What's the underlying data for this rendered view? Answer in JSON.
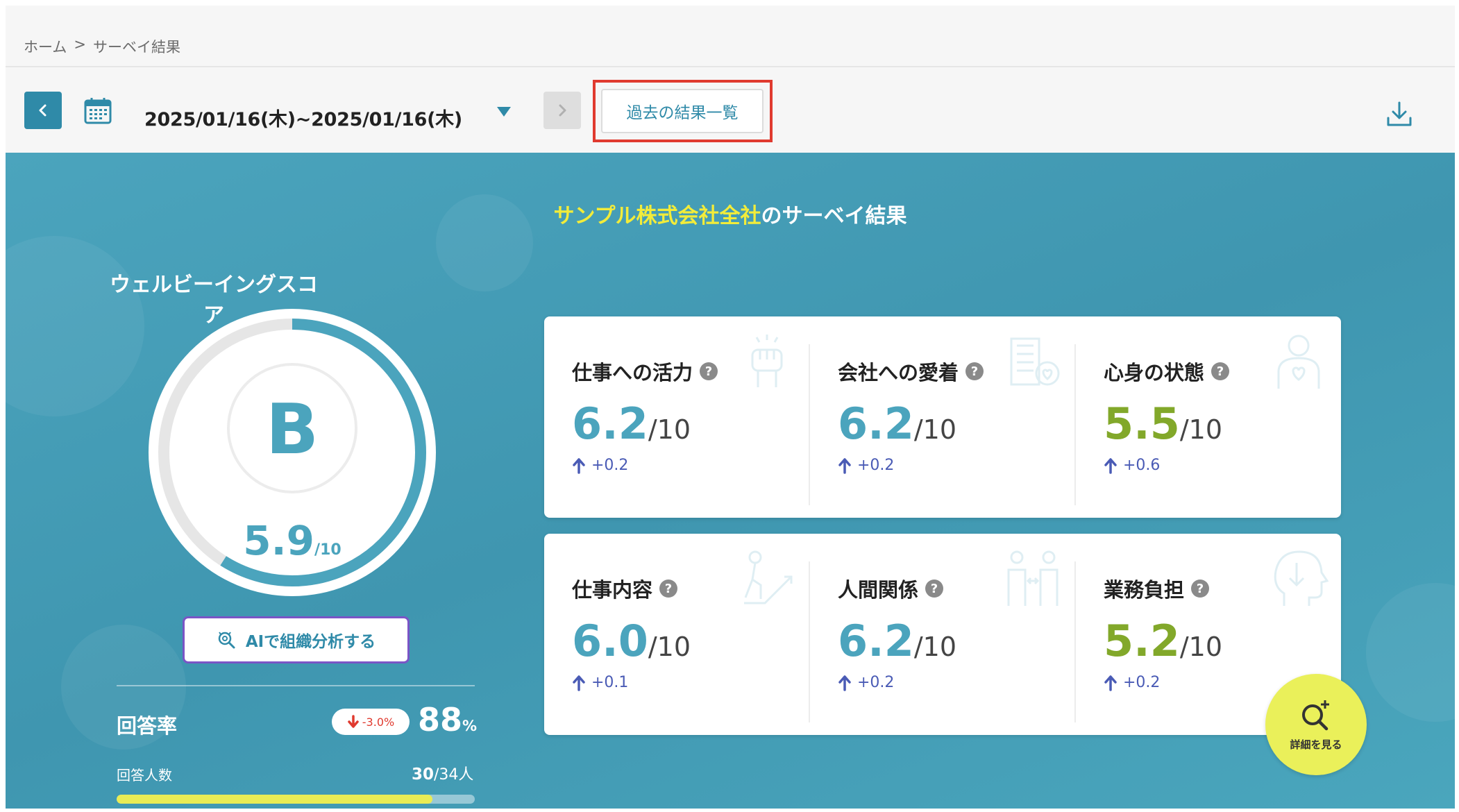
{
  "breadcrumb": {
    "home": "ホーム",
    "separator": ">",
    "current": "サーベイ結果"
  },
  "toolbar": {
    "date_range": "2025/01/16(木)~2025/01/16(木)",
    "history_button": "過去の結果一覧"
  },
  "panel": {
    "title_company": "サンプル株式会社全社",
    "title_suffix": "のサーベイ結果"
  },
  "wellbeing": {
    "label": "ウェルビーイングスコア",
    "grade": "B",
    "score": "5.9",
    "score_denominator": "/10",
    "score_fraction": 0.59,
    "ai_button": "AIで組織分析する"
  },
  "response": {
    "rate_label": "回答率",
    "rate_change": "-3.0%",
    "rate_value": "88",
    "rate_unit": "%",
    "count_label": "回答人数",
    "count_answered": "30",
    "count_total": "/34人",
    "progress_fraction": 0.882
  },
  "metrics": [
    {
      "name": "仕事への活力",
      "score": "6.2",
      "denominator": "/10",
      "delta": "+0.2",
      "color": "#4ba4bd",
      "icon": "fist-icon"
    },
    {
      "name": "会社への愛着",
      "score": "6.2",
      "denominator": "/10",
      "delta": "+0.2",
      "color": "#4ba4bd",
      "icon": "building-heart-icon"
    },
    {
      "name": "心身の状態",
      "score": "5.5",
      "denominator": "/10",
      "delta": "+0.6",
      "color": "#82a82a",
      "icon": "person-heart-icon"
    },
    {
      "name": "仕事内容",
      "score": "6.0",
      "denominator": "/10",
      "delta": "+0.1",
      "color": "#4ba4bd",
      "icon": "climbing-person-icon"
    },
    {
      "name": "人間関係",
      "score": "6.2",
      "denominator": "/10",
      "delta": "+0.2",
      "color": "#4ba4bd",
      "icon": "two-people-icon"
    },
    {
      "name": "業務負担",
      "score": "5.2",
      "denominator": "/10",
      "delta": "+0.2",
      "color": "#82a82a",
      "icon": "head-down-arrow-icon"
    }
  ],
  "detail_button": {
    "label": "詳細を見る"
  },
  "colors": {
    "accent": "#2f8aa8",
    "panel": "#4ba4bd",
    "highlight": "#e03a2f",
    "yellow": "#f2ec3a",
    "green": "#82a82a",
    "delta_blue": "#4a5bb5"
  }
}
